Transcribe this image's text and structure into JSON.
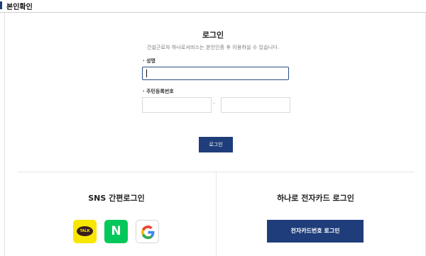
{
  "section": {
    "title": "본인확인"
  },
  "login": {
    "title": "로그인",
    "description": "건설근로자 하나로서비스는 본인인증 후 이용하실 수 있습니다.",
    "name_label": "· 성명",
    "name_value": "",
    "ssn_label": "· 주민등록번호",
    "ssn_front_value": "",
    "ssn_back_value": "",
    "ssn_separator": "-",
    "button_label": "로그인"
  },
  "sns": {
    "title": "SNS 간편로그인",
    "kakao_text": "TALK",
    "naver_text": "N",
    "items": [
      "kakao-icon",
      "naver-icon",
      "google-icon"
    ]
  },
  "card_login": {
    "title": "하나로 전자카드 로그인",
    "button_label": "전자카드번호 로그인"
  },
  "colors": {
    "accent": "#1f3d7a",
    "kakao": "#f7e600",
    "naver": "#03c75a"
  }
}
